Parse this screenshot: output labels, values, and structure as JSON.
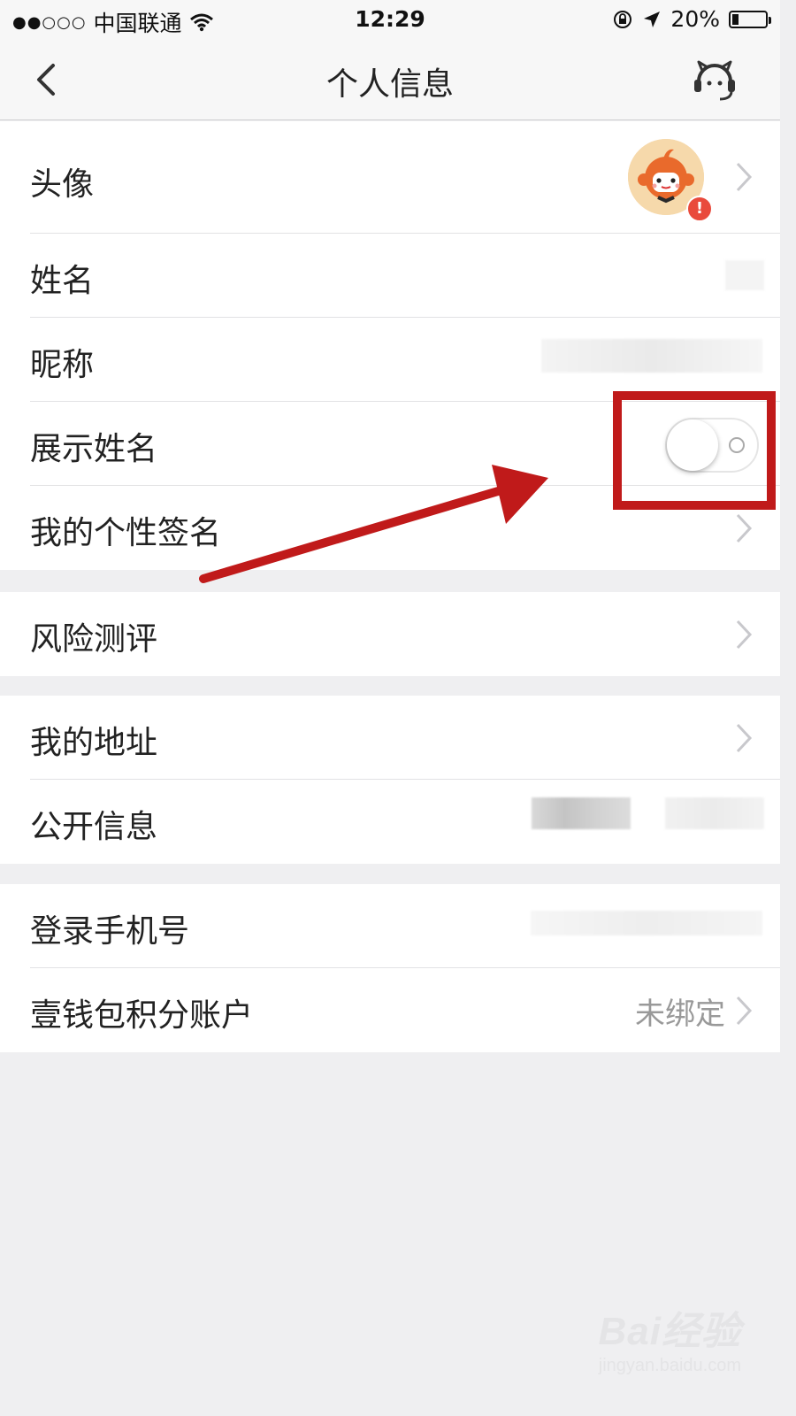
{
  "status_bar": {
    "signal": "●●○○○",
    "carrier": "中国联通",
    "time": "12:29",
    "battery": "20%",
    "battery_level": 0.2,
    "icons": [
      "wifi-icon",
      "rotation-lock-icon",
      "location-arrow-icon",
      "battery-icon"
    ]
  },
  "nav": {
    "title": "个人信息",
    "back_icon": "chevron-left-icon",
    "service_icon": "customer-service-icon"
  },
  "rows": {
    "avatar": {
      "label": "头像",
      "badge": "!"
    },
    "name": {
      "label": "姓名"
    },
    "nickname": {
      "label": "昵称"
    },
    "show_name": {
      "label": "展示姓名",
      "toggle_on": false
    },
    "signature": {
      "label": "我的个性签名"
    },
    "risk": {
      "label": "风险测评"
    },
    "address": {
      "label": "我的地址"
    },
    "public_info": {
      "label": "公开信息"
    },
    "phone": {
      "label": "登录手机号"
    },
    "points": {
      "label": "壹钱包积分账户",
      "value": "未绑定"
    }
  },
  "annotation": {
    "color": "#c01a1a"
  },
  "watermark": {
    "main": "Bai经验",
    "sub": "jingyan.baidu.com"
  },
  "colors": {
    "background": "#efeff1",
    "label": "#222222",
    "secondary": "#999999",
    "badge": "#e94a3c"
  }
}
